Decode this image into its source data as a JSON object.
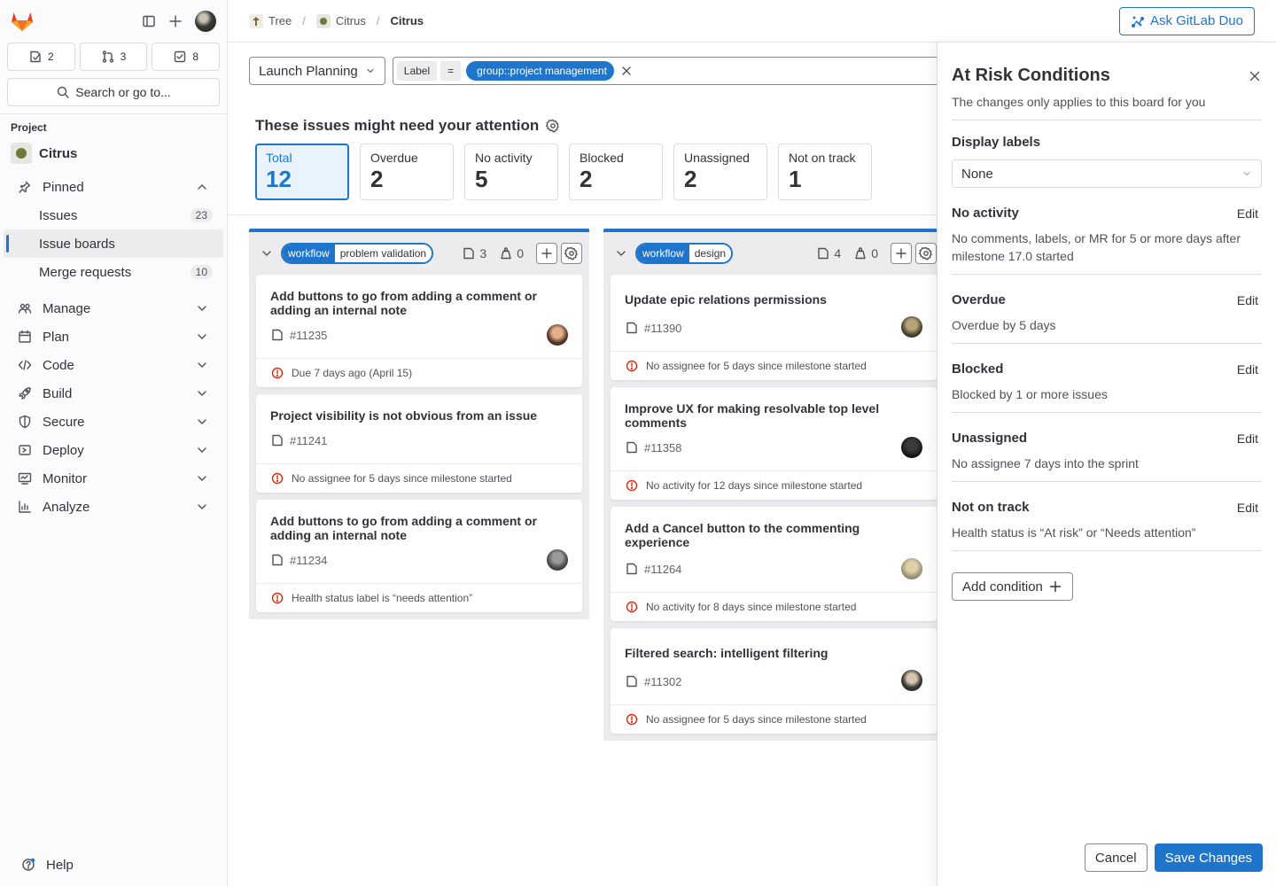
{
  "colors": {
    "accent": "#1f75cb",
    "danger": "#dd2b0e",
    "brand_orange": "#e24329"
  },
  "sidebar": {
    "counts": [
      {
        "icon": "issues-icon",
        "value": "2"
      },
      {
        "icon": "merge-request-icon",
        "value": "3"
      },
      {
        "icon": "todo-icon",
        "value": "8"
      }
    ],
    "search_label": "Search or go to...",
    "section_label": "Project",
    "project_name": "Citrus",
    "pinned_label": "Pinned",
    "pinned_items": [
      {
        "label": "Issues",
        "badge": "23"
      },
      {
        "label": "Issue boards",
        "badge": ""
      },
      {
        "label": "Merge requests",
        "badge": "10"
      }
    ],
    "nav": [
      {
        "label": "Manage",
        "icon": "users-icon"
      },
      {
        "label": "Plan",
        "icon": "calendar-icon"
      },
      {
        "label": "Code",
        "icon": "code-icon"
      },
      {
        "label": "Build",
        "icon": "rocket-icon"
      },
      {
        "label": "Secure",
        "icon": "shield-icon"
      },
      {
        "label": "Deploy",
        "icon": "deploy-icon"
      },
      {
        "label": "Monitor",
        "icon": "monitor-icon"
      },
      {
        "label": "Analyze",
        "icon": "chart-icon"
      }
    ],
    "help_label": "Help"
  },
  "breadcrumb": {
    "items": [
      "Tree",
      "Citrus",
      "Citrus"
    ]
  },
  "duo_button": "Ask GitLab Duo",
  "filter": {
    "board_select": "Launch Planning",
    "token_key": "Label",
    "token_op": "=",
    "token_value": "group::project management"
  },
  "attention": {
    "title": "These issues might need your attention",
    "stats": [
      {
        "label": "Total",
        "value": "12",
        "active": true
      },
      {
        "label": "Overdue",
        "value": "2"
      },
      {
        "label": "No activity",
        "value": "5"
      },
      {
        "label": "Blocked",
        "value": "2"
      },
      {
        "label": "Unassigned",
        "value": "2"
      },
      {
        "label": "Not on track",
        "value": "1"
      }
    ]
  },
  "lists": [
    {
      "label_key": "workflow",
      "label_value": "problem validation",
      "issue_count": "3",
      "weight": "0",
      "cards": [
        {
          "title": "Add buttons to go from adding a comment or adding an internal note",
          "ref": "#11235",
          "risk": "Due 7 days ago (April 15)"
        },
        {
          "title": "Project visibility is not obvious from an issue",
          "ref": "#11241",
          "risk": "No assignee for 5 days since milestone started"
        },
        {
          "title": "Add buttons to go from adding a comment or adding an internal note",
          "ref": "#11234",
          "risk": "Health status label is “needs attention”"
        }
      ]
    },
    {
      "label_key": "workflow",
      "label_value": "design",
      "issue_count": "4",
      "weight": "0",
      "cards": [
        {
          "title": "Update epic relations permissions",
          "ref": "#11390",
          "risk": "No assignee for 5 days since milestone started"
        },
        {
          "title": "Improve UX for making resolvable top level comments",
          "ref": "#11358",
          "risk": "No activity for 12 days since milestone started"
        },
        {
          "title": "Add a Cancel button to the commenting experience",
          "ref": "#11264",
          "risk": "No activity for 8 days since milestone started"
        },
        {
          "title": "Filtered search: intelligent filtering",
          "ref": "#11302",
          "risk": "No assignee for 5 days since milestone started"
        }
      ]
    }
  ],
  "drawer": {
    "title": "At Risk Conditions",
    "subtitle": "The changes only applies to this board for you",
    "display_labels_label": "Display labels",
    "display_labels_value": "None",
    "edit_label": "Edit",
    "conditions": [
      {
        "name": "No activity",
        "desc": "No comments, labels, or MR for 5 or more days after milestone 17.0 started"
      },
      {
        "name": "Overdue",
        "desc": "Overdue by 5 days"
      },
      {
        "name": "Blocked",
        "desc": "Blocked by 1 or more issues"
      },
      {
        "name": "Unassigned",
        "desc": "No assignee 7 days into the sprint"
      },
      {
        "name": "Not on track",
        "desc": "Health status is “At risk” or “Needs attention”"
      }
    ],
    "add_condition": "Add condition",
    "cancel": "Cancel",
    "save": "Save Changes"
  }
}
